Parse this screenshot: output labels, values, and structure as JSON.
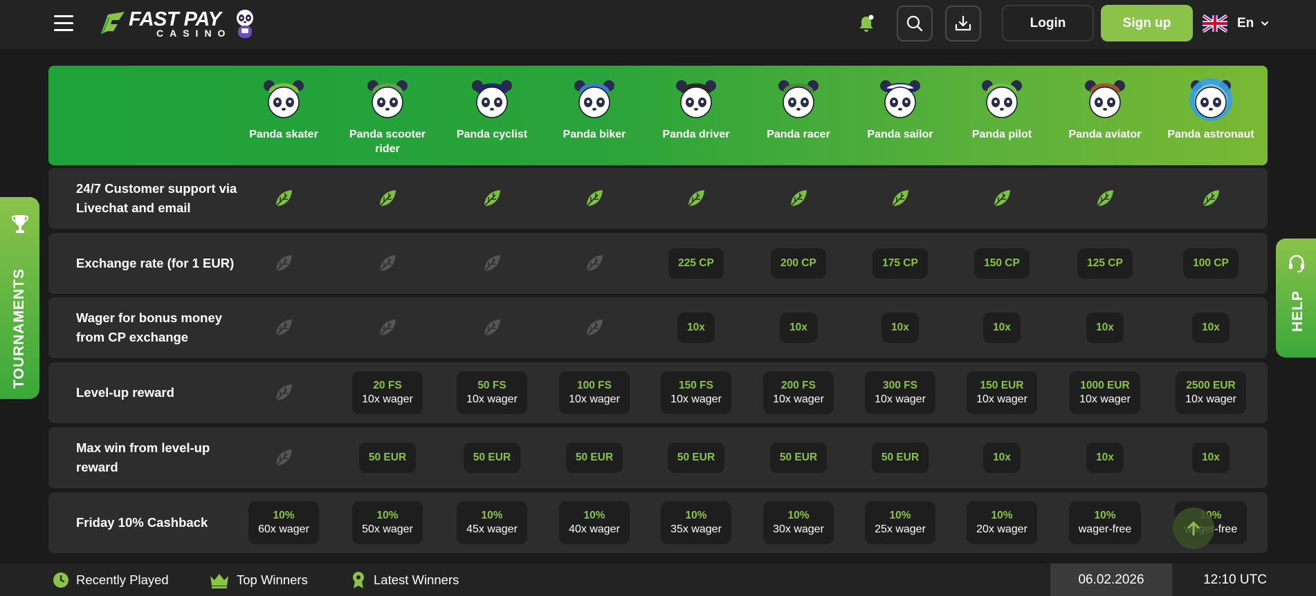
{
  "header": {
    "logo_top": "FAST PAY",
    "logo_bottom": "CASINO",
    "login_label": "Login",
    "signup_label": "Sign up",
    "language": "En"
  },
  "tiers": [
    {
      "name": "Panda skater",
      "accent": "#7ac142"
    },
    {
      "name": "Panda scooter rider",
      "accent": "#5aa84a"
    },
    {
      "name": "Panda cyclist",
      "accent": "#1e2a6e"
    },
    {
      "name": "Panda biker",
      "accent": "#3a7bd5"
    },
    {
      "name": "Panda driver",
      "accent": "#2b2b2b"
    },
    {
      "name": "Panda racer",
      "accent": "#4c8a3c"
    },
    {
      "name": "Panda sailor",
      "accent": "#ffffff"
    },
    {
      "name": "Panda pilot",
      "accent": "#6cc24a"
    },
    {
      "name": "Panda aviator",
      "accent": "#a0582a"
    },
    {
      "name": "Panda astronaut",
      "accent": "#3aa0e0"
    }
  ],
  "rows": [
    {
      "label": "24/7 Customer support via Livechat and email",
      "cells": [
        {
          "type": "leaf",
          "active": true
        },
        {
          "type": "leaf",
          "active": true
        },
        {
          "type": "leaf",
          "active": true
        },
        {
          "type": "leaf",
          "active": true
        },
        {
          "type": "leaf",
          "active": true
        },
        {
          "type": "leaf",
          "active": true
        },
        {
          "type": "leaf",
          "active": true
        },
        {
          "type": "leaf",
          "active": true
        },
        {
          "type": "leaf",
          "active": true
        },
        {
          "type": "leaf",
          "active": true
        }
      ]
    },
    {
      "label": "Exchange rate (for 1 EUR)",
      "cells": [
        {
          "type": "leaf",
          "active": false
        },
        {
          "type": "leaf",
          "active": false
        },
        {
          "type": "leaf",
          "active": false
        },
        {
          "type": "leaf",
          "active": false
        },
        {
          "type": "pill",
          "main": "225 CP"
        },
        {
          "type": "pill",
          "main": "200 CP"
        },
        {
          "type": "pill",
          "main": "175 CP"
        },
        {
          "type": "pill",
          "main": "150 CP"
        },
        {
          "type": "pill",
          "main": "125 CP"
        },
        {
          "type": "pill",
          "main": "100 CP"
        }
      ]
    },
    {
      "label": "Wager for bonus money from CP exchange",
      "cells": [
        {
          "type": "leaf",
          "active": false
        },
        {
          "type": "leaf",
          "active": false
        },
        {
          "type": "leaf",
          "active": false
        },
        {
          "type": "leaf",
          "active": false
        },
        {
          "type": "pill",
          "main": "10x"
        },
        {
          "type": "pill",
          "main": "10x"
        },
        {
          "type": "pill",
          "main": "10x"
        },
        {
          "type": "pill",
          "main": "10x"
        },
        {
          "type": "pill",
          "main": "10x"
        },
        {
          "type": "pill",
          "main": "10x"
        }
      ]
    },
    {
      "label": "Level-up reward",
      "cells": [
        {
          "type": "leaf",
          "active": false
        },
        {
          "type": "pill",
          "main": "20 FS",
          "sub": "10x wager"
        },
        {
          "type": "pill",
          "main": "50 FS",
          "sub": "10x wager"
        },
        {
          "type": "pill",
          "main": "100 FS",
          "sub": "10x wager"
        },
        {
          "type": "pill",
          "main": "150 FS",
          "sub": "10x wager"
        },
        {
          "type": "pill",
          "main": "200 FS",
          "sub": "10x wager"
        },
        {
          "type": "pill",
          "main": "300 FS",
          "sub": "10x wager"
        },
        {
          "type": "pill",
          "main": "150 EUR",
          "sub": "10x wager"
        },
        {
          "type": "pill",
          "main": "1000 EUR",
          "sub": "10x wager"
        },
        {
          "type": "pill",
          "main": "2500 EUR",
          "sub": "10x wager"
        }
      ]
    },
    {
      "label": "Max win from level-up reward",
      "cells": [
        {
          "type": "leaf",
          "active": false
        },
        {
          "type": "pill",
          "main": "50 EUR"
        },
        {
          "type": "pill",
          "main": "50 EUR"
        },
        {
          "type": "pill",
          "main": "50 EUR"
        },
        {
          "type": "pill",
          "main": "50 EUR"
        },
        {
          "type": "pill",
          "main": "50 EUR"
        },
        {
          "type": "pill",
          "main": "50 EUR"
        },
        {
          "type": "pill",
          "main": "10x"
        },
        {
          "type": "pill",
          "main": "10x"
        },
        {
          "type": "pill",
          "main": "10x"
        }
      ]
    },
    {
      "label": "Friday 10% Cashback",
      "cells": [
        {
          "type": "pill",
          "main": "10%",
          "sub": "60x wager"
        },
        {
          "type": "pill",
          "main": "10%",
          "sub": "50x wager"
        },
        {
          "type": "pill",
          "main": "10%",
          "sub": "45x wager"
        },
        {
          "type": "pill",
          "main": "10%",
          "sub": "40x wager"
        },
        {
          "type": "pill",
          "main": "10%",
          "sub": "35x wager"
        },
        {
          "type": "pill",
          "main": "10%",
          "sub": "30x wager"
        },
        {
          "type": "pill",
          "main": "10%",
          "sub": "25x wager"
        },
        {
          "type": "pill",
          "main": "10%",
          "sub": "20x wager"
        },
        {
          "type": "pill",
          "main": "10%",
          "sub": "wager-free"
        },
        {
          "type": "pill",
          "main": "10%",
          "sub": "wager-free"
        }
      ]
    }
  ],
  "side": {
    "tournaments_label": "TOURNAMENTS",
    "help_label": "HELP"
  },
  "bottom": {
    "recently_played": "Recently Played",
    "top_winners": "Top Winners",
    "latest_winners": "Latest Winners",
    "date": "06.02.2026",
    "time": "12:10 UTC"
  },
  "icons": {
    "menu": "hamburger-icon",
    "notifications": "bell-icon",
    "search": "search-icon",
    "download": "download-icon",
    "language_flag": "uk-flag-icon",
    "tournaments": "trophy-icon",
    "help": "headset-icon",
    "scroll_top": "arrow-up-icon",
    "recently_played": "clock-icon",
    "top_winners": "crown-icon",
    "latest_winners": "medal-icon",
    "table_check": "leaf-icon"
  },
  "colors": {
    "accent": "#8bc34a",
    "background": "#1b1b1b",
    "row": "#2d2d2d",
    "pill": "#1e1e1e",
    "leaf_active": "#7bc142",
    "leaf_inactive": "#555555"
  }
}
